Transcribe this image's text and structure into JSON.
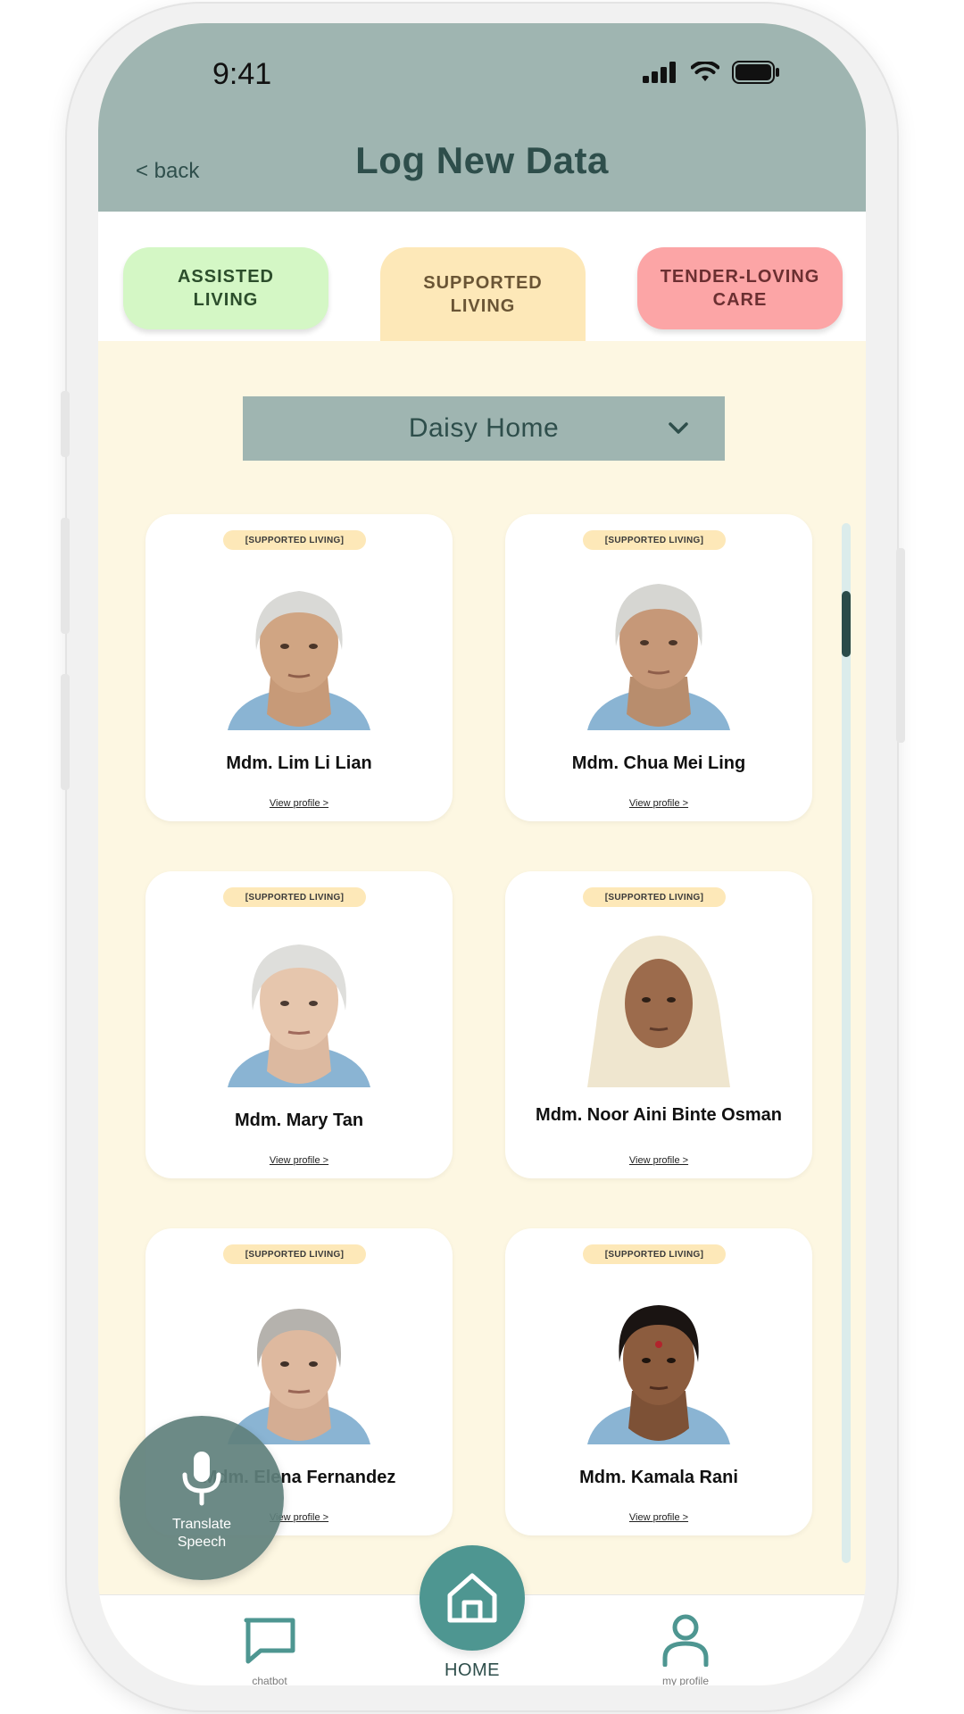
{
  "status_bar": {
    "time": "9:41"
  },
  "header": {
    "back_label": "< back",
    "title": "Log New Data"
  },
  "tabs": [
    {
      "label": "ASSISTED\nLIVING",
      "color": "#d4f7c5"
    },
    {
      "label": "SUPPORTED\nLIVING",
      "color": "#fde8b8",
      "selected": true
    },
    {
      "label": "TENDER-LOVING\nCARE",
      "color": "#fca5a6"
    }
  ],
  "dropdown": {
    "selected": "Daisy Home"
  },
  "residents": [
    {
      "badge": "[SUPPORTED LIVING]",
      "name": "Mdm. Lim Li Lian",
      "link": "View profile >"
    },
    {
      "badge": "[SUPPORTED LIVING]",
      "name": "Mdm. Chua Mei Ling",
      "link": "View profile >"
    },
    {
      "badge": "[SUPPORTED LIVING]",
      "name": "Mdm. Mary Tan",
      "link": "View profile >"
    },
    {
      "badge": "[SUPPORTED LIVING]",
      "name": "Mdm. Noor Aini Binte Osman",
      "link": "View profile >"
    },
    {
      "badge": "[SUPPORTED LIVING]",
      "name": "Mdm. Elena Fernandez",
      "link": "View profile >"
    },
    {
      "badge": "[SUPPORTED LIVING]",
      "name": "Mdm. Kamala Rani",
      "link": "View profile >"
    }
  ],
  "translate": {
    "label": "Translate\nSpeech",
    "icon": "microphone-icon"
  },
  "nav": {
    "chatbot_label": "chatbot",
    "home_label": "HOME",
    "profile_label": "my profile"
  },
  "colors": {
    "header": "#9fb5b1",
    "accent": "#4e9691",
    "background": "#fdf7e2",
    "title": "#2e4e4b"
  }
}
